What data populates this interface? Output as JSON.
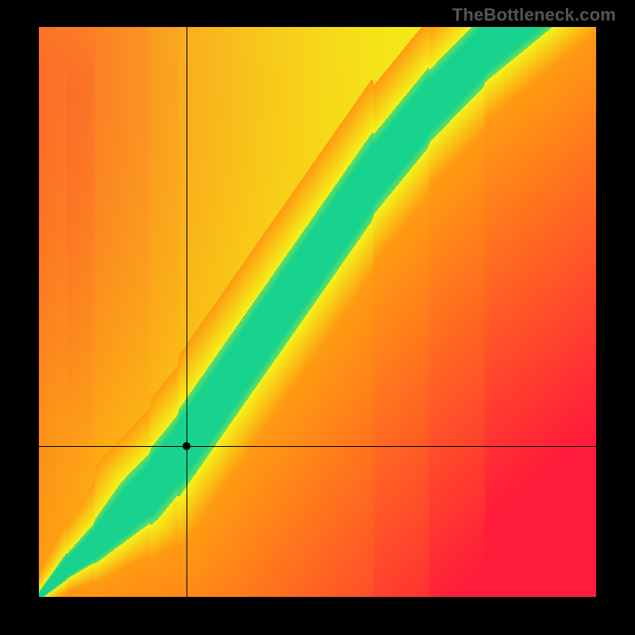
{
  "watermark": "TheBottleneck.com",
  "chart_data": {
    "type": "heatmap",
    "title": "",
    "xlabel": "",
    "ylabel": "",
    "xlim": [
      0,
      1
    ],
    "ylim": [
      0,
      1
    ],
    "grid": false,
    "legend_position": "none",
    "series": [
      {
        "name": "optimal-band",
        "description": "Green band where components are balanced (no bottleneck).",
        "x": [
          0.0,
          0.05,
          0.1,
          0.15,
          0.2,
          0.25,
          0.3,
          0.35,
          0.4,
          0.45,
          0.5,
          0.55,
          0.6,
          0.65,
          0.7,
          0.75,
          0.8,
          0.85
        ],
        "y": [
          0.0,
          0.05,
          0.09,
          0.14,
          0.19,
          0.25,
          0.32,
          0.39,
          0.46,
          0.53,
          0.6,
          0.67,
          0.74,
          0.8,
          0.86,
          0.91,
          0.96,
          1.0
        ]
      }
    ],
    "marker": {
      "x": 0.265,
      "y": 0.265,
      "label": ""
    },
    "crosshair": {
      "x": 0.265,
      "y": 0.265
    },
    "color_scale": {
      "balanced": "#18d38d",
      "near": "#f4f31a",
      "mid": "#ff9b12",
      "far": "#ff1b3a"
    },
    "band_half_width": 0.045,
    "yellow_half_width": 0.055
  }
}
